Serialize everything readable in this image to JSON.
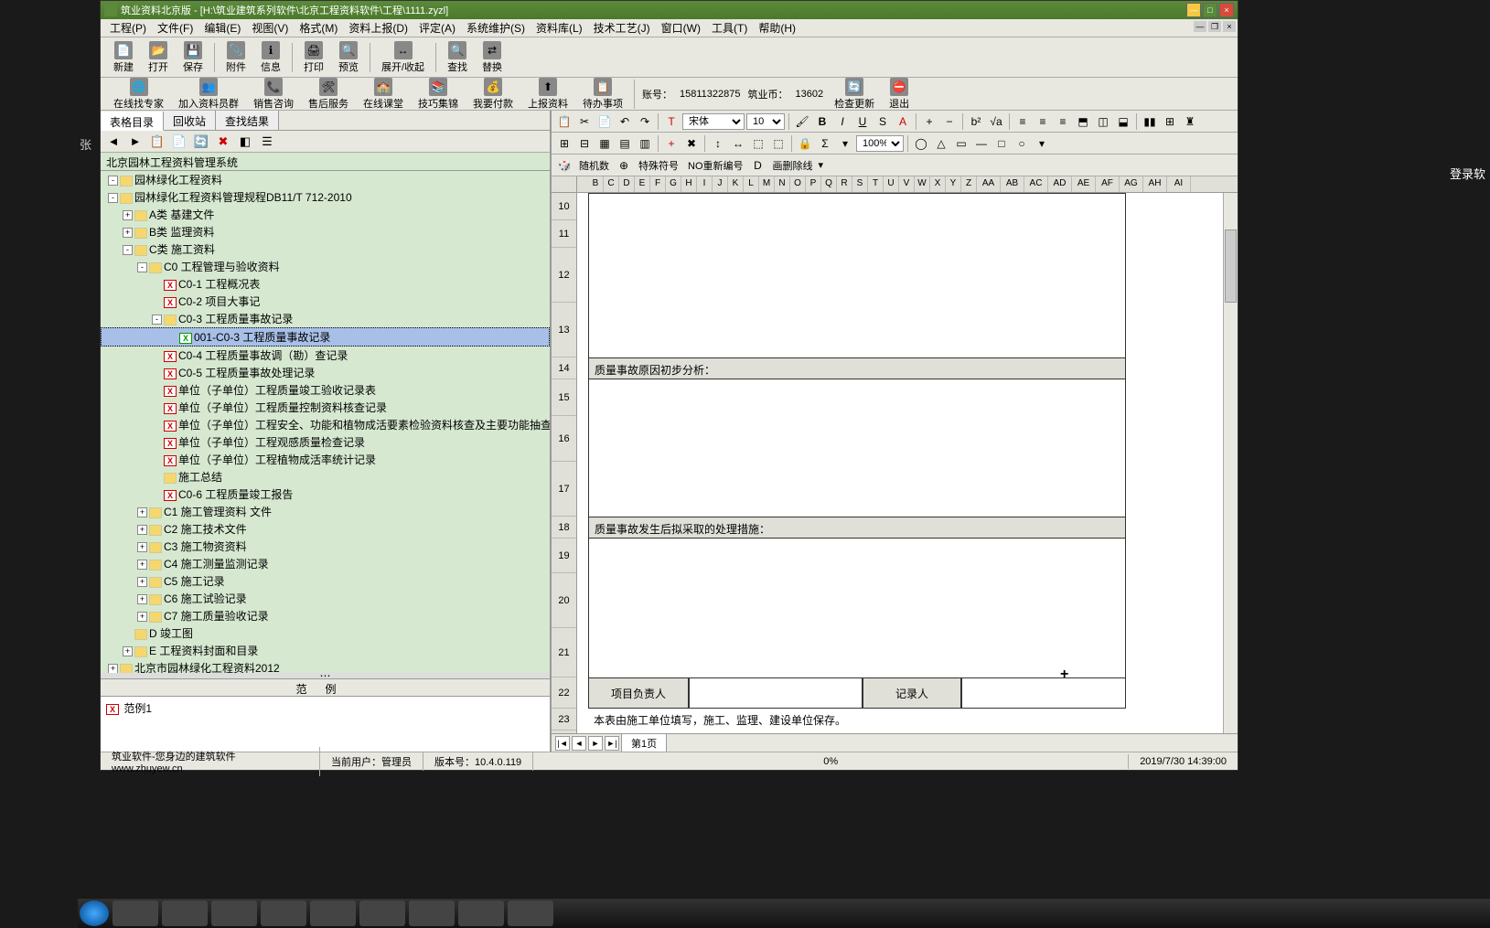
{
  "desktop": {
    "left_text": "张",
    "right_text": "登录软"
  },
  "window": {
    "title": "筑业资料北京版 - [H:\\筑业建筑系列软件\\北京工程资料软件\\工程\\1111.zyzl]"
  },
  "menubar": [
    "工程(P)",
    "文件(F)",
    "编辑(E)",
    "视图(V)",
    "格式(M)",
    "资料上报(D)",
    "评定(A)",
    "系统维护(S)",
    "资料库(L)",
    "技术工艺(J)",
    "窗口(W)",
    "工具(T)",
    "帮助(H)"
  ],
  "toolbar1": [
    {
      "icon": "📄",
      "label": "新建"
    },
    {
      "icon": "📂",
      "label": "打开"
    },
    {
      "icon": "💾",
      "label": "保存"
    },
    {
      "sep": true
    },
    {
      "icon": "📎",
      "label": "附件"
    },
    {
      "icon": "ℹ",
      "label": "信息"
    },
    {
      "sep": true
    },
    {
      "icon": "🖨",
      "label": "打印"
    },
    {
      "icon": "🔍",
      "label": "预览"
    },
    {
      "sep": true
    },
    {
      "icon": "↔",
      "label": "展开/收起"
    },
    {
      "sep": true
    },
    {
      "icon": "🔍",
      "label": "查找"
    },
    {
      "icon": "⇄",
      "label": "替换"
    }
  ],
  "toolbar2": [
    {
      "icon": "🌐",
      "label": "在线找专家"
    },
    {
      "icon": "👥",
      "label": "加入资料员群"
    },
    {
      "icon": "📞",
      "label": "销售咨询"
    },
    {
      "icon": "🛠",
      "label": "售后服务"
    },
    {
      "icon": "🏫",
      "label": "在线课堂"
    },
    {
      "icon": "📚",
      "label": "技巧集锦"
    },
    {
      "icon": "💰",
      "label": "我要付款"
    },
    {
      "icon": "⬆",
      "label": "上报资料"
    },
    {
      "icon": "📋",
      "label": "待办事项"
    },
    {
      "sep": true
    },
    {
      "text": "账号："
    },
    {
      "text": "15811322875"
    },
    {
      "text": "筑业币："
    },
    {
      "text": "13602"
    },
    {
      "icon": "🔄",
      "label": "检查更新"
    },
    {
      "icon": "⛔",
      "label": "退出"
    }
  ],
  "left_tabs": [
    "表格目录",
    "回收站",
    "查找结果"
  ],
  "breadcrumb": "北京园林工程资料管理系统",
  "tree": [
    {
      "d": 0,
      "t": "-",
      "i": "f",
      "label": "园林绿化工程资料"
    },
    {
      "d": 0,
      "t": "-",
      "i": "f",
      "label": "园林绿化工程资料管理规程DB11/T 712-2010"
    },
    {
      "d": 1,
      "t": "+",
      "i": "f",
      "label": "A类  基建文件"
    },
    {
      "d": 1,
      "t": "+",
      "i": "f",
      "label": "B类  监理资料"
    },
    {
      "d": 1,
      "t": "-",
      "i": "f",
      "label": "C类  施工资料"
    },
    {
      "d": 2,
      "t": "-",
      "i": "f",
      "label": "C0 工程管理与验收资料"
    },
    {
      "d": 3,
      "t": "",
      "i": "x",
      "label": "C0-1  工程概况表"
    },
    {
      "d": 3,
      "t": "",
      "i": "x",
      "label": "C0-2  项目大事记"
    },
    {
      "d": 3,
      "t": "-",
      "i": "f",
      "label": "C0-3  工程质量事故记录"
    },
    {
      "d": 4,
      "t": "",
      "i": "xg",
      "label": "001-C0-3 工程质量事故记录",
      "sel": true
    },
    {
      "d": 3,
      "t": "",
      "i": "x",
      "label": "C0-4  工程质量事故调（勘）查记录"
    },
    {
      "d": 3,
      "t": "",
      "i": "x",
      "label": "C0-5  工程质量事故处理记录"
    },
    {
      "d": 3,
      "t": "",
      "i": "x",
      "label": "单位（子单位）工程质量竣工验收记录表"
    },
    {
      "d": 3,
      "t": "",
      "i": "x",
      "label": "单位（子单位）工程质量控制资料核查记录"
    },
    {
      "d": 3,
      "t": "",
      "i": "x",
      "label": "单位（子单位）工程安全、功能和植物成活要素检验资料核查及主要功能抽查记录"
    },
    {
      "d": 3,
      "t": "",
      "i": "x",
      "label": "单位（子单位）工程观感质量检查记录"
    },
    {
      "d": 3,
      "t": "",
      "i": "x",
      "label": "单位（子单位）工程植物成活率统计记录"
    },
    {
      "d": 3,
      "t": "",
      "i": "f",
      "label": "施工总结"
    },
    {
      "d": 3,
      "t": "",
      "i": "x",
      "label": "C0-6  工程质量竣工报告"
    },
    {
      "d": 2,
      "t": "+",
      "i": "f",
      "label": "C1 施工管理资料  文件"
    },
    {
      "d": 2,
      "t": "+",
      "i": "f",
      "label": "C2 施工技术文件"
    },
    {
      "d": 2,
      "t": "+",
      "i": "f",
      "label": "C3 施工物资资料"
    },
    {
      "d": 2,
      "t": "+",
      "i": "f",
      "label": "C4 施工测量监测记录"
    },
    {
      "d": 2,
      "t": "+",
      "i": "f",
      "label": "C5 施工记录"
    },
    {
      "d": 2,
      "t": "+",
      "i": "f",
      "label": "C6 施工试验记录"
    },
    {
      "d": 2,
      "t": "+",
      "i": "f",
      "label": "C7 施工质量验收记录"
    },
    {
      "d": 1,
      "t": "",
      "i": "f",
      "label": "D 竣工图"
    },
    {
      "d": 1,
      "t": "+",
      "i": "f",
      "label": "E 工程资料封面和目录"
    },
    {
      "d": 0,
      "t": "+",
      "i": "f",
      "label": "北京市园林绿化工程资料2012"
    }
  ],
  "example": {
    "header": "范例",
    "item": "范例1"
  },
  "right_toolbar1": {
    "font": "宋体",
    "size": "10",
    "zoom": "100%"
  },
  "right_toolbar2": {
    "btn1": "随机数",
    "btn2": "特殊符号",
    "btn3": "NO重新编号",
    "btn4": "画删除线"
  },
  "spreadsheet": {
    "cols": [
      "B",
      "C",
      "D",
      "E",
      "F",
      "G",
      "H",
      "I",
      "J",
      "K",
      "L",
      "M",
      "N",
      "O",
      "P",
      "Q",
      "R",
      "S",
      "T",
      "U",
      "V",
      "W",
      "X",
      "Y",
      "Z",
      "AA",
      "AB",
      "AC",
      "AD",
      "AE",
      "AF",
      "AG",
      "AH",
      "AI"
    ],
    "rows": [
      10,
      11,
      12,
      13,
      14,
      15,
      16,
      17,
      18,
      19,
      20,
      21,
      22,
      23
    ],
    "row14_text": "质量事故原因初步分析：",
    "row18_text": "质量事故发生后拟采取的处理措施：",
    "row22_col1": "项目负责人",
    "row22_col3": "记录人",
    "row23_text": "本表由施工单位填写，施工、监理、建设单位保存。",
    "sheet_tab": "第1页"
  },
  "statusbar": {
    "left": "筑业软件-您身边的建筑软件  www.zhuyew.cn",
    "user_label": "当前用户：",
    "user_value": "管理员",
    "ver_label": "版本号：",
    "ver_value": "10.4.0.119",
    "pct": "0%",
    "datetime": "2019/7/30  14:39:00"
  }
}
